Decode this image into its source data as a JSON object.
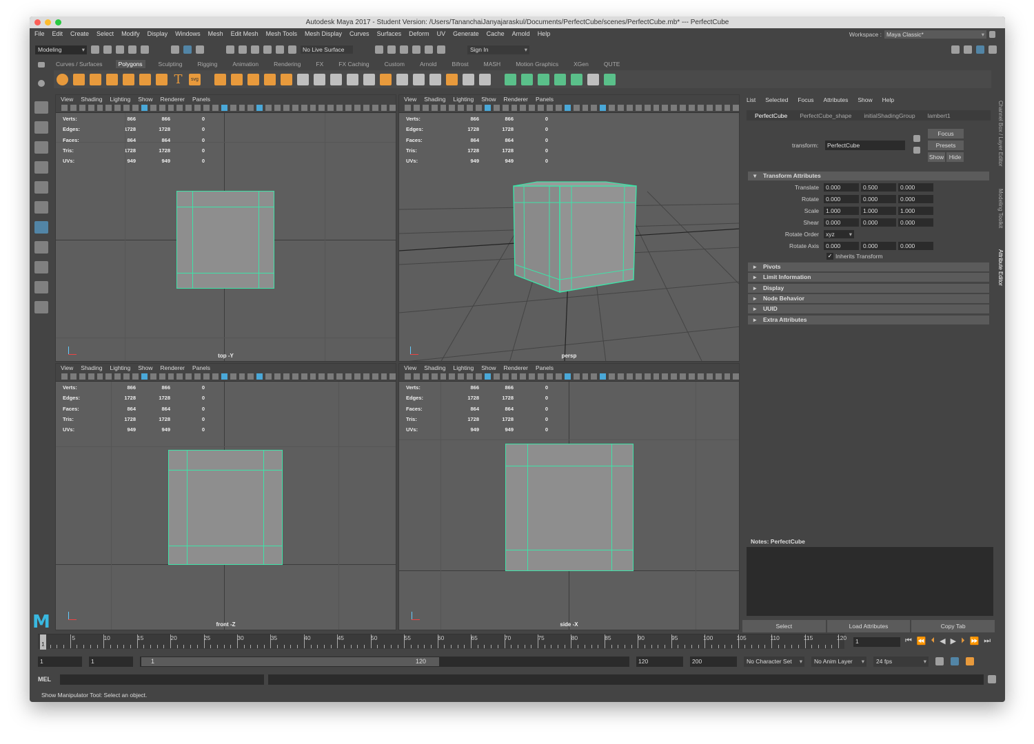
{
  "window": {
    "title": "Autodesk Maya 2017 - Student Version: /Users/TananchaiJanyajaraskul/Documents/PerfectCube/scenes/PerfectCube.mb*   ---   PerfectCube"
  },
  "menubar": [
    "File",
    "Edit",
    "Create",
    "Select",
    "Modify",
    "Display",
    "Windows",
    "Mesh",
    "Edit Mesh",
    "Mesh Tools",
    "Mesh Display",
    "Curves",
    "Surfaces",
    "Deform",
    "UV",
    "Generate",
    "Cache",
    "Arnold",
    "Help"
  ],
  "workspace": {
    "label": "Workspace :",
    "value": "Maya Classic*"
  },
  "statusline": {
    "mode": "Modeling",
    "live_surface": "No Live Surface",
    "sign_in": "Sign In"
  },
  "shelf_tabs": [
    "Curves / Surfaces",
    "Polygons",
    "Sculpting",
    "Rigging",
    "Animation",
    "Rendering",
    "FX",
    "FX Caching",
    "Custom",
    "Arnold",
    "Bifrost",
    "MASH",
    "Motion Graphics",
    "XGen",
    "QUTE"
  ],
  "shelf_active": "Polygons",
  "shelf_icons": [
    "sphere-icon",
    "cube-icon",
    "cylinder-icon",
    "cone-icon",
    "torus-icon",
    "plane-icon",
    "pipe-icon",
    "text-icon",
    "svg-icon"
  ],
  "vp_menu": [
    "View",
    "Shading",
    "Lighting",
    "Show",
    "Renderer",
    "Panels"
  ],
  "hud": {
    "rows": [
      {
        "k": "Verts:",
        "a": "866",
        "b": "866",
        "c": "0"
      },
      {
        "k": "Edges:",
        "a": "1728",
        "b": "1728",
        "c": "0"
      },
      {
        "k": "Faces:",
        "a": "864",
        "b": "864",
        "c": "0"
      },
      {
        "k": "Tris:",
        "a": "1728",
        "b": "1728",
        "c": "0"
      },
      {
        "k": "UVs:",
        "a": "949",
        "b": "949",
        "c": "0"
      }
    ]
  },
  "viewports": {
    "top": "top -Y",
    "persp": "persp",
    "front": "front -Z",
    "side": "side -X"
  },
  "right_panel": {
    "menu": [
      "List",
      "Selected",
      "Focus",
      "Attributes",
      "Show",
      "Help"
    ],
    "tabs": [
      "PerfectCube",
      "PerfectCube_shape",
      "initialShadingGroup",
      "lambert1"
    ],
    "transform_label": "transform:",
    "transform_value": "PerfectCube",
    "buttons": {
      "focus": "Focus",
      "presets": "Presets",
      "show": "Show",
      "hide": "Hide"
    },
    "section_transform": "Transform Attributes",
    "translate": {
      "label": "Translate",
      "x": "0.000",
      "y": "0.500",
      "z": "0.000"
    },
    "rotate": {
      "label": "Rotate",
      "x": "0.000",
      "y": "0.000",
      "z": "0.000"
    },
    "scale": {
      "label": "Scale",
      "x": "1.000",
      "y": "1.000",
      "z": "1.000"
    },
    "shear": {
      "label": "Shear",
      "x": "0.000",
      "y": "0.000",
      "z": "0.000"
    },
    "rotate_order": {
      "label": "Rotate Order",
      "value": "xyz"
    },
    "rotate_axis": {
      "label": "Rotate Axis",
      "x": "0.000",
      "y": "0.000",
      "z": "0.000"
    },
    "inherits": "Inherits Transform",
    "sections": [
      "Pivots",
      "Limit Information",
      "Display",
      "Node Behavior",
      "UUID",
      "Extra Attributes"
    ],
    "notes_label": "Notes:  PerfectCube",
    "bottom": {
      "select": "Select",
      "load": "Load Attributes",
      "copy": "Copy Tab"
    }
  },
  "side_tabs": {
    "channel_box": "Channel Box / Layer Editor",
    "modeling_toolkit": "Modeling Toolkit",
    "attribute_editor": "Attribute Editor"
  },
  "timeline": {
    "ticks": [
      "5",
      "10",
      "15",
      "20",
      "25",
      "30",
      "35",
      "40",
      "45",
      "50",
      "55",
      "60",
      "65",
      "70",
      "75",
      "80",
      "85",
      "90",
      "95",
      "100",
      "105",
      "110",
      "115",
      "120"
    ],
    "current_frame": "1",
    "frame_field": "1"
  },
  "range": {
    "start": "1",
    "anim_start": "1",
    "slider_start": "1",
    "slider_end": "120",
    "end": "120",
    "anim_end": "200",
    "character_set": "No Character Set",
    "anim_layer": "No Anim Layer",
    "fps": "24 fps"
  },
  "mel": {
    "label": "MEL"
  },
  "help_line": "Show Manipulator Tool: Select an object.",
  "colors": {
    "accent": "#3ee3a8",
    "viewport": "#5e5e5e",
    "shelf_icon": "#e89a3c",
    "maya_logo": "#39b8e0"
  }
}
